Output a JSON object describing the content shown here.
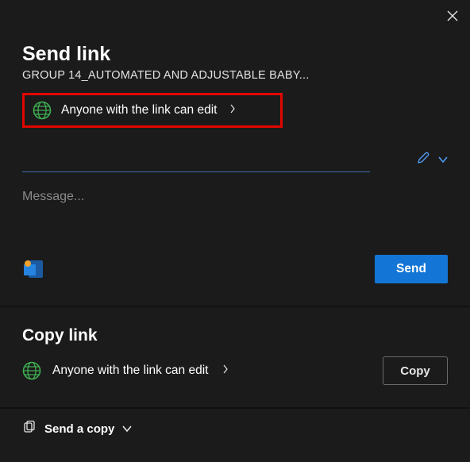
{
  "header": {
    "title": "Send link",
    "filename": "GROUP 14_AUTOMATED AND ADJUSTABLE BABY..."
  },
  "permission": {
    "label": "Anyone with the link can edit"
  },
  "message": {
    "placeholder": "Message..."
  },
  "actions": {
    "send_label": "Send",
    "copy_title": "Copy link",
    "copy_label": "Copy",
    "send_copy_label": "Send a copy"
  }
}
